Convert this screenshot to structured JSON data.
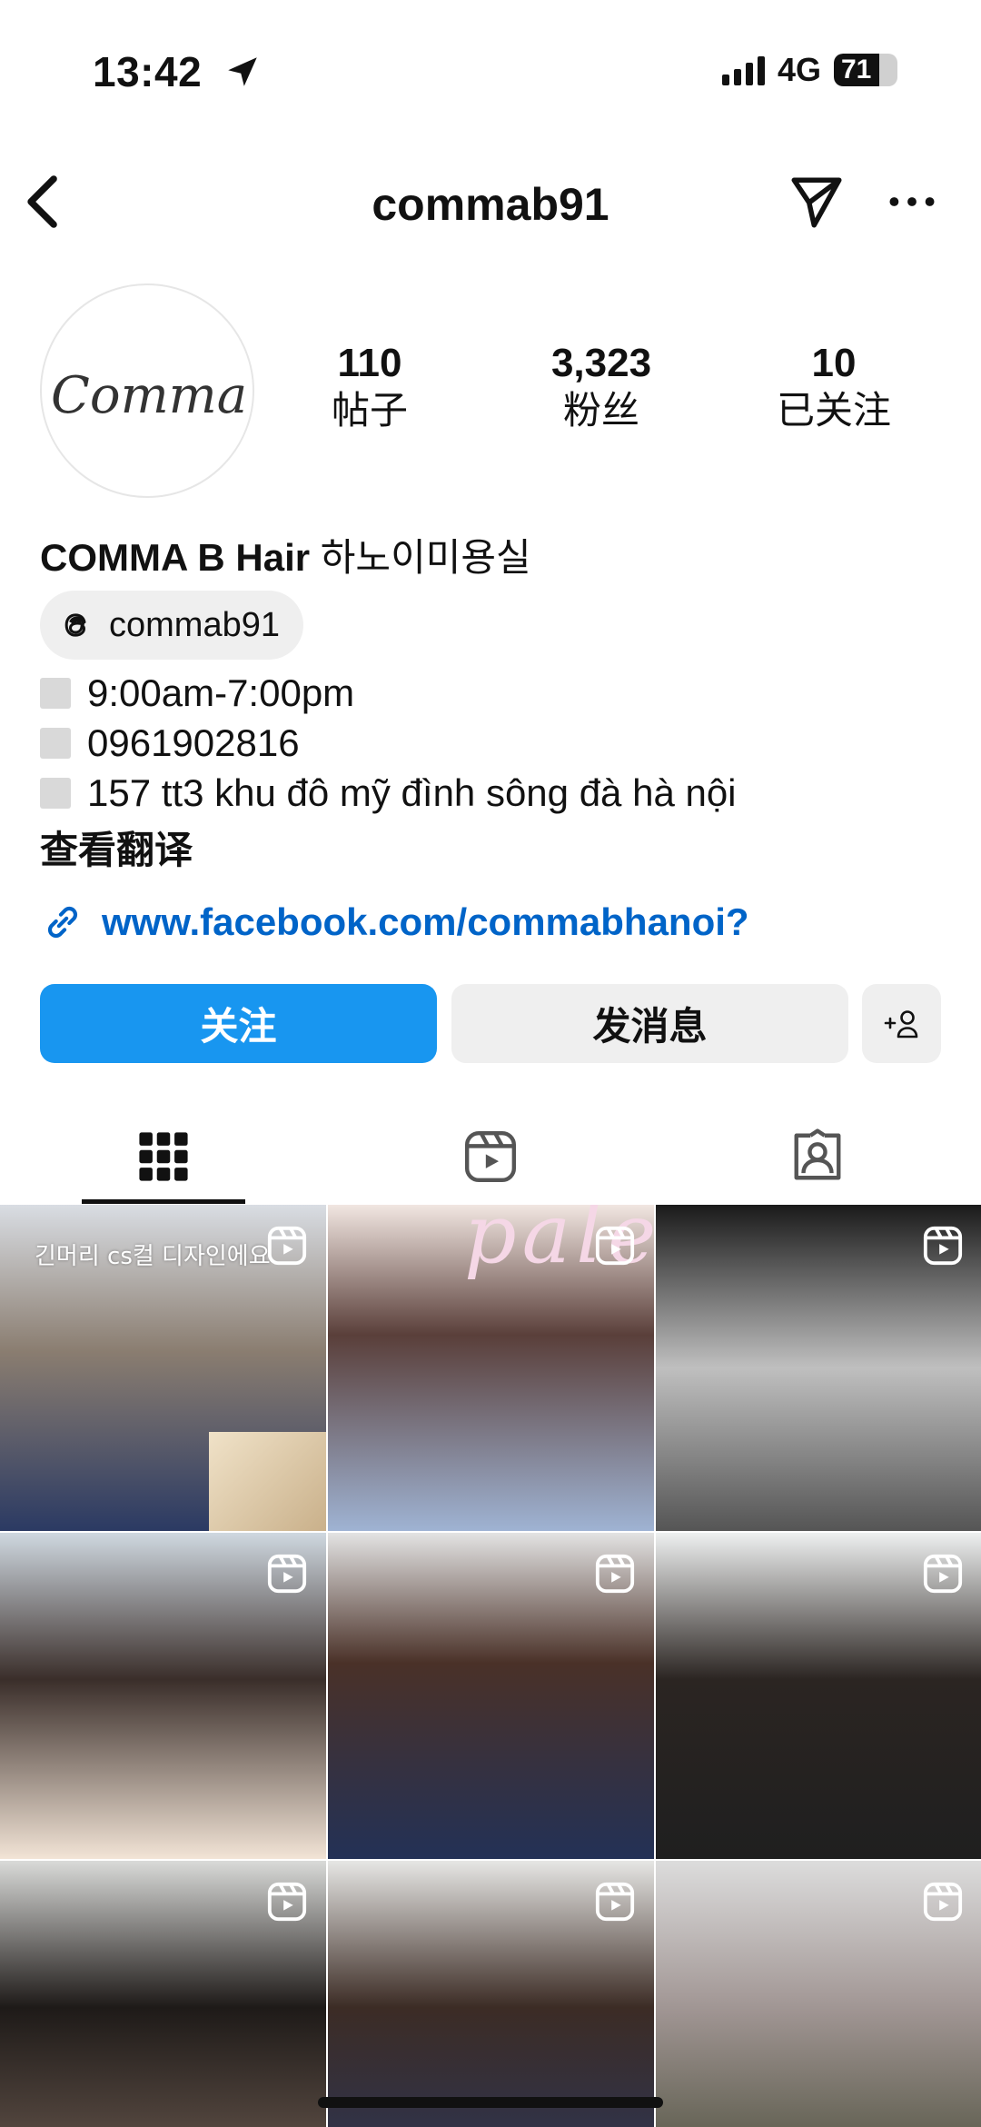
{
  "status_bar": {
    "time": "13:42",
    "network": "4G",
    "battery": "71",
    "battery_level": 0.71
  },
  "topnav": {
    "username": "commab91"
  },
  "profile": {
    "avatar_text": "Comma B",
    "stats": [
      {
        "value": "110",
        "label": "帖子"
      },
      {
        "value": "3,323",
        "label": "粉丝"
      },
      {
        "value": "10",
        "label": "已关注"
      }
    ],
    "name_bold": "COMMA B Hair",
    "name_rest": "하노이미용실",
    "threads_handle": "commab91",
    "bio": [
      "9:00am-7:00pm",
      "0961902816",
      "157 tt3 khu đô mỹ đình sông đà hà nội"
    ],
    "translate_label": "查看翻译",
    "link": "www.facebook.com/commabhanoi?"
  },
  "actions": {
    "follow": "关注",
    "message": "发消息"
  },
  "tabs": [
    "posts-grid-icon",
    "reels-icon",
    "tagged-icon"
  ],
  "grid": {
    "posts": [
      {
        "caption": "긴머리 cs컬 디자인에요",
        "overlay": "",
        "type": "reel"
      },
      {
        "caption": "",
        "overlay": "pale",
        "type": "reel"
      },
      {
        "caption": "",
        "overlay": "",
        "type": "reel"
      },
      {
        "caption": "",
        "overlay": "",
        "type": "reel"
      },
      {
        "caption": "",
        "overlay": "",
        "type": "reel"
      },
      {
        "caption": "",
        "overlay": "",
        "type": "reel"
      },
      {
        "caption": "",
        "overlay": "",
        "type": "reel"
      },
      {
        "caption": "",
        "overlay": "",
        "type": "reel"
      },
      {
        "caption": "",
        "overlay": "",
        "type": "reel"
      }
    ]
  },
  "colors": {
    "accent": "#1896f0",
    "link": "#0064c8",
    "button_bg": "#efefef"
  }
}
